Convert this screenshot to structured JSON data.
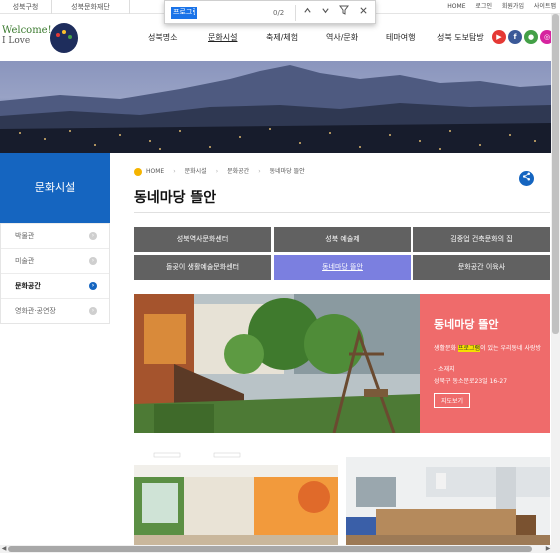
{
  "topbar": {
    "sites": [
      "성북구청",
      "성북문화재단"
    ],
    "utils": [
      "HOME",
      "로그인",
      "회원가입",
      "사이트맵"
    ]
  },
  "findbar": {
    "query": "프로그램",
    "count": "0/2",
    "icons": [
      "chevron-up-icon",
      "chevron-down-icon",
      "filter-icon",
      "close-icon"
    ]
  },
  "header": {
    "logo_line1": "Welcome!",
    "logo_line2": "I Love",
    "nav": [
      "성북명소",
      "문화시설",
      "축제/체험",
      "역사/문화",
      "테마여행",
      "성북 도보탐방"
    ],
    "active_nav": "문화시설",
    "social": [
      {
        "name": "youtube-icon",
        "label": "▶",
        "color": "#e53935"
      },
      {
        "name": "facebook-icon",
        "label": "f",
        "color": "#3b5998"
      },
      {
        "name": "chat-icon",
        "label": "●",
        "color": "#43a047"
      },
      {
        "name": "instagram-icon",
        "label": "◎",
        "color": "#d6249f"
      }
    ]
  },
  "sidebar": {
    "title": "문화시설",
    "items": [
      {
        "label": "박물관",
        "active": false
      },
      {
        "label": "미술관",
        "active": false
      },
      {
        "label": "문화공간",
        "active": true
      },
      {
        "label": "영화관·공연장",
        "active": false
      }
    ]
  },
  "breadcrumb": [
    "HOME",
    "문화시설",
    "문화공간",
    "동네마당 뜰안"
  ],
  "page_title": "동네마당 뜰안",
  "tabs": [
    {
      "label": "성북역사문화센터",
      "active": false
    },
    {
      "label": "성북 예술제",
      "active": false
    },
    {
      "label": "김중업 건축문화의 집",
      "active": false
    },
    {
      "label": "돌곶이 생활예술문화센터",
      "active": false
    },
    {
      "label": "동네마당 뜰안",
      "active": true
    },
    {
      "label": "문화공간 이육사",
      "active": false
    }
  ],
  "feature": {
    "title": "동네마당 뜰안",
    "desc_before": "생활문화 ",
    "desc_highlight": "프로그램",
    "desc_after": "이 있는 우리동네 사랑방",
    "addr_label": "- 소재지",
    "addr": "성북구 동소문로23일 16-27",
    "map_button": "지도보기"
  },
  "colors": {
    "primary": "#1565c0",
    "tab": "#616161",
    "tab_active": "#7b7fe0",
    "feature_panel": "#ef6b6b",
    "highlight": "#f5e000"
  }
}
